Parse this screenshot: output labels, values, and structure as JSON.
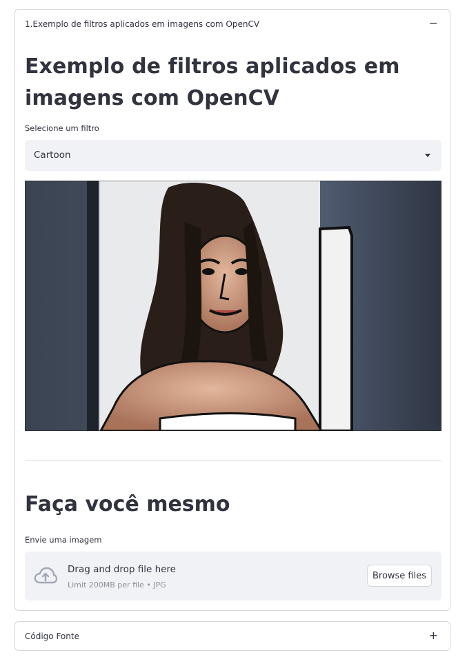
{
  "expander_main": {
    "title": "1.Exemplo de filtros aplicados em imagens com OpenCV",
    "toggle_icon": "−"
  },
  "main": {
    "heading": "Exemplo de filtros aplicados em imagens com OpenCV",
    "filter_select": {
      "label": "Selecione um filtro",
      "value": "Cartoon"
    },
    "section_heading": "Faça você mesmo",
    "uploader": {
      "label": "Envie uma imagem",
      "title": "Drag and drop file here",
      "limit": "Limit 200MB per file • JPG",
      "button": "Browse files",
      "icon": "cloud-upload-icon"
    }
  },
  "expander_source": {
    "title": "Código Fonte",
    "toggle_icon": "+"
  },
  "colors": {
    "text": "#31333f",
    "input_bg": "#f0f2f6",
    "border": "#d6d6d9",
    "muted": "#8b8f98"
  }
}
